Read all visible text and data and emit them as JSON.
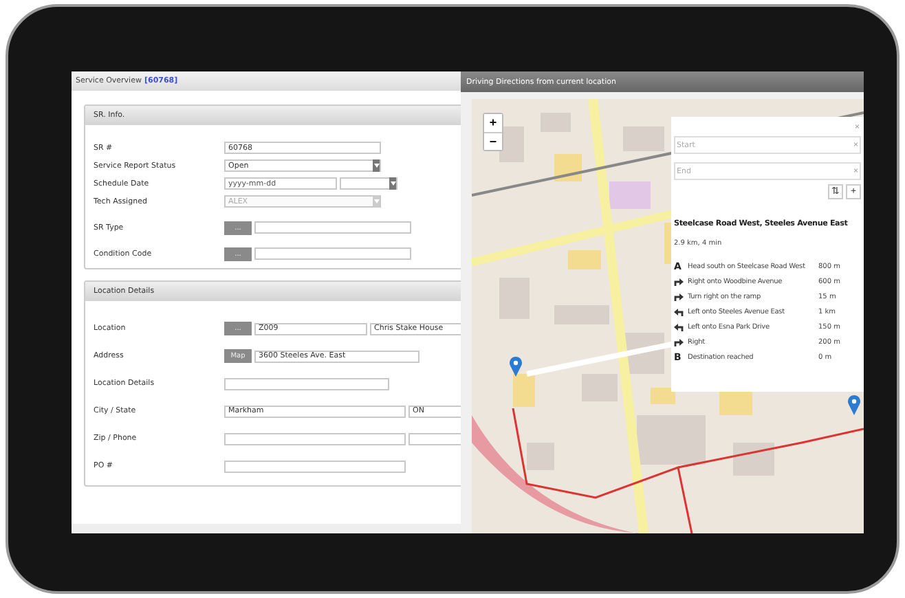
{
  "service_panel": {
    "title": "Service Overview",
    "record_id": "[60768]",
    "sections": [
      {
        "title": "SR. Info.",
        "rows": [
          {
            "label": "SR #",
            "fields": [
              {
                "kind": "short-input",
                "value": "60768"
              }
            ]
          },
          {
            "label": "Service Report Status",
            "fields": [
              {
                "kind": "select",
                "value": "Open",
                "disabled": false
              }
            ]
          },
          {
            "label": "Schedule Date",
            "fields": [
              {
                "kind": "date-input",
                "placeholder": "yyyy-mm-dd"
              },
              {
                "kind": "small-select",
                "disabled": false
              }
            ]
          },
          {
            "label": "Tech Assigned",
            "fields": [
              {
                "kind": "select",
                "value": "ALEX",
                "disabled": true
              }
            ]
          },
          {
            "label": "SR Type",
            "fields": [
              {
                "kind": "button",
                "text": "..."
              },
              {
                "kind": "short-input"
              }
            ]
          },
          {
            "label": "Condition Code",
            "fields": [
              {
                "kind": "button",
                "text": "..."
              },
              {
                "kind": "short-input"
              }
            ]
          }
        ]
      },
      {
        "title": "Location Details",
        "rows": [
          {
            "label": "Location",
            "fields": [
              {
                "kind": "button",
                "text": "..."
              },
              {
                "kind": "date-input",
                "value": "Z009"
              },
              {
                "kind": "fill-input",
                "value": "Chris Stake House"
              }
            ]
          },
          {
            "label": "Address",
            "fields": [
              {
                "kind": "button",
                "text": "Map"
              },
              {
                "kind": "fill-input",
                "value": "3600 Steeles Ave. East"
              }
            ]
          },
          {
            "label": "Location Details",
            "fields": [
              {
                "kind": "fill-input"
              }
            ]
          },
          {
            "label": "City / State",
            "fields": [
              {
                "kind": "medium-input",
                "value": "Markham"
              },
              {
                "kind": "fill-input",
                "value": "ON"
              }
            ]
          },
          {
            "label": "Zip / Phone",
            "fields": [
              {
                "kind": "medium-input"
              },
              {
                "kind": "fill-input"
              }
            ]
          },
          {
            "label": "PO #",
            "fields": [
              {
                "kind": "medium-input"
              }
            ]
          }
        ]
      }
    ]
  },
  "directions_panel": {
    "title": "Driving Directions from current location",
    "zoom_in": "+",
    "zoom_out": "−",
    "close": "×",
    "waypoints": [
      {
        "placeholder": "Start",
        "clear": "×"
      },
      {
        "placeholder": "End",
        "clear": "×"
      }
    ],
    "swap": "⇅",
    "add": "+",
    "route_title": "Steelcase Road West, Steeles Avenue East",
    "summary": "2.9 km, 4 min",
    "steps": [
      {
        "kind": "start",
        "marker": "A",
        "text": "Head south on Steelcase Road West",
        "distance": "800 m"
      },
      {
        "kind": "right",
        "text": "Right onto Woodbine Avenue",
        "distance": "600 m"
      },
      {
        "kind": "right",
        "text": "Turn right on the ramp",
        "distance": "15 m"
      },
      {
        "kind": "left",
        "text": "Left onto Steeles Avenue East",
        "distance": "1 km"
      },
      {
        "kind": "left",
        "text": "Left onto Esna Park Drive",
        "distance": "150 m"
      },
      {
        "kind": "right",
        "text": "Right",
        "distance": "200 m"
      },
      {
        "kind": "end",
        "marker": "B",
        "text": "Destination reached",
        "distance": "0 m"
      }
    ]
  }
}
